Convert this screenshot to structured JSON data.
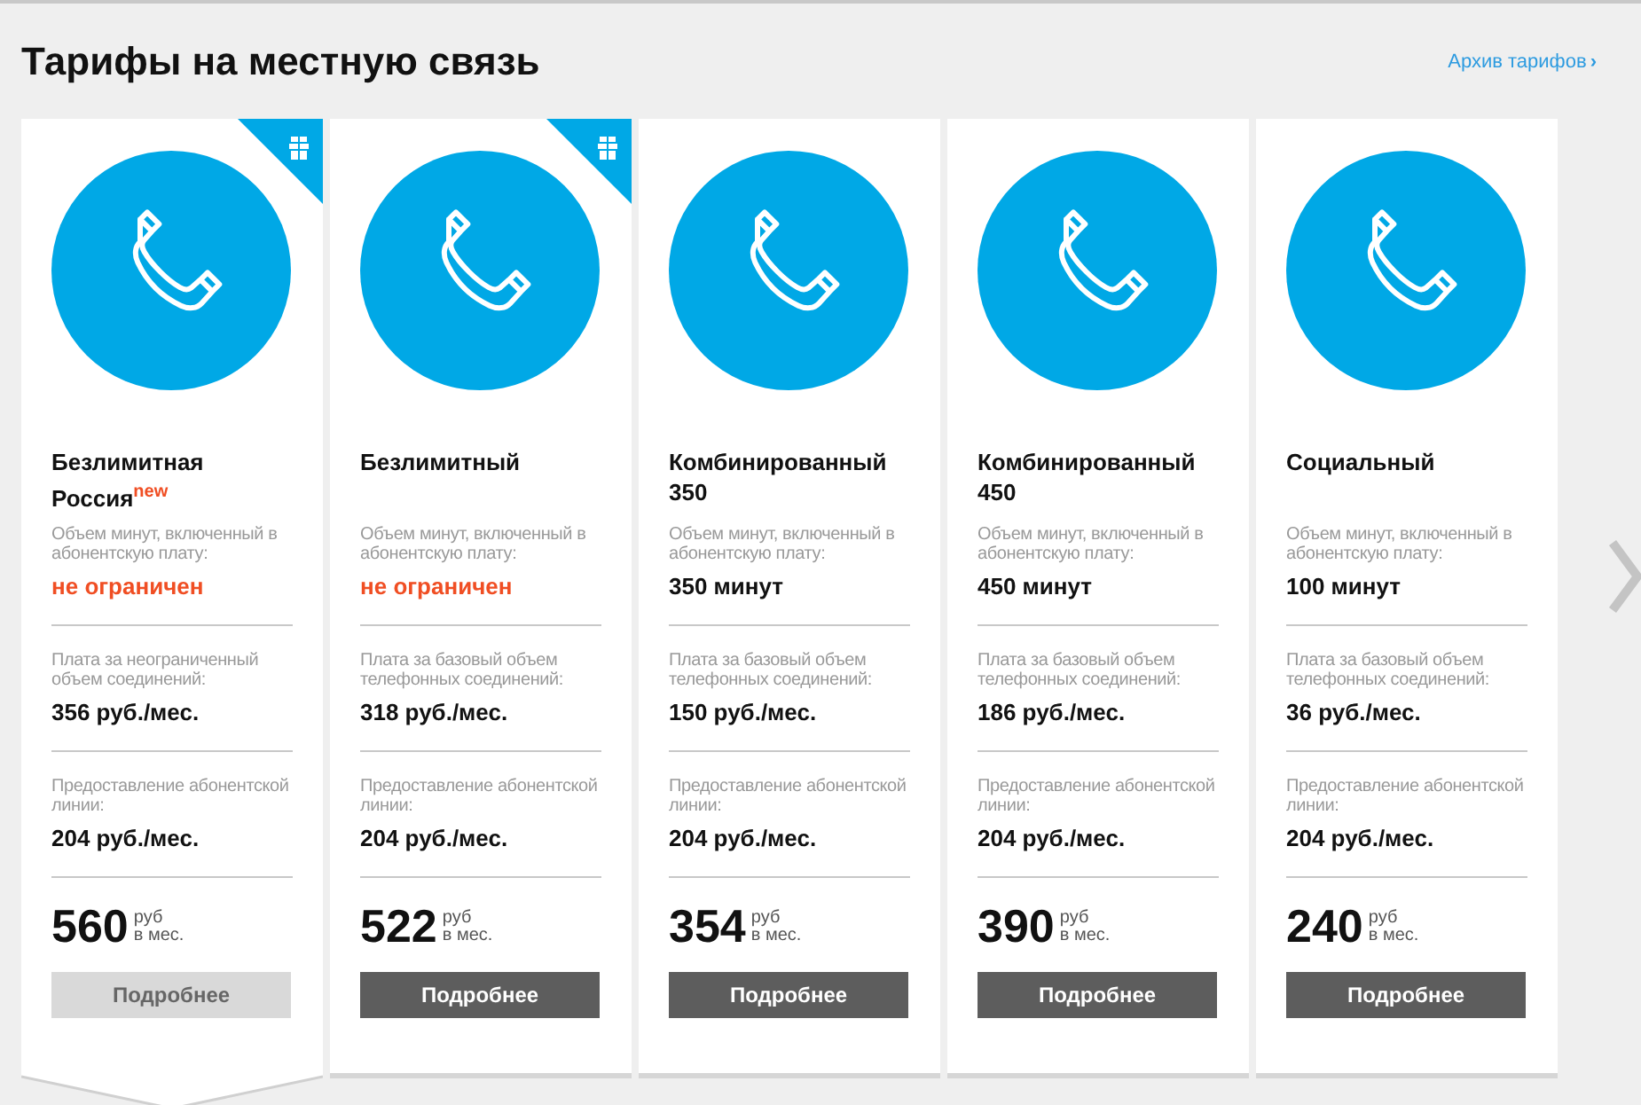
{
  "page": {
    "title": "Тарифы на местную связь",
    "archive_link": "Архив тарифов",
    "archive_arrow": "›"
  },
  "tariffs": [
    {
      "name": "Безлимитная Россия$^{new}$",
      "selected": true,
      "gift": true,
      "rows": [
        {
          "label": "Объем минут, включенный в абонентскую плату:",
          "value": "не ограничен",
          "highlight": true
        },
        {
          "label": "Плата за неограниченный объем соединений:",
          "value": "356 руб./мес.",
          "highlight": false
        },
        {
          "label": "Предоставление абонентской линии:",
          "value": "204 руб./мес.",
          "highlight": false
        }
      ],
      "price": "560",
      "unit": "руб",
      "period": "в мес.",
      "button": "Подробнее"
    },
    {
      "name": "Безлимитный",
      "selected": false,
      "gift": true,
      "rows": [
        {
          "label": "Объем минут, включенный в абонентскую плату:",
          "value": "не ограничен",
          "highlight": true
        },
        {
          "label": "Плата за базовый объем телефонных соединений:",
          "value": "318 руб./мес.",
          "highlight": false
        },
        {
          "label": "Предоставление абонентской линии:",
          "value": "204 руб./мес.",
          "highlight": false
        }
      ],
      "price": "522",
      "unit": "руб",
      "period": "в мес.",
      "button": "Подробнее"
    },
    {
      "name": "Комбинированный 350",
      "selected": false,
      "gift": false,
      "rows": [
        {
          "label": "Объем минут, включенный в абонентскую плату:",
          "value": "350 минут",
          "highlight": false
        },
        {
          "label": "Плата за базовый объем телефонных соединений:",
          "value": "150 руб./мес.",
          "highlight": false
        },
        {
          "label": "Предоставление абонентской линии:",
          "value": "204 руб./мес.",
          "highlight": false
        }
      ],
      "price": "354",
      "unit": "руб",
      "period": "в мес.",
      "button": "Подробнее"
    },
    {
      "name": "Комбинированный 450",
      "selected": false,
      "gift": false,
      "rows": [
        {
          "label": "Объем минут, включенный в абонентскую плату:",
          "value": "450 минут",
          "highlight": false
        },
        {
          "label": "Плата за базовый объем телефонных соединений:",
          "value": "186 руб./мес.",
          "highlight": false
        },
        {
          "label": "Предоставление абонентской линии:",
          "value": "204 руб./мес.",
          "highlight": false
        }
      ],
      "price": "390",
      "unit": "руб",
      "period": "в мес.",
      "button": "Подробнее"
    },
    {
      "name": "Социальный",
      "selected": false,
      "gift": false,
      "rows": [
        {
          "label": "Объем минут, включенный в абонентскую плату:",
          "value": "100 минут",
          "highlight": false
        },
        {
          "label": "Плата за базовый объем телефонных соединений:",
          "value": "36 руб./мес.",
          "highlight": false
        },
        {
          "label": "Предоставление абонентской линии:",
          "value": "204 руб./мес.",
          "highlight": false
        }
      ],
      "price": "240",
      "unit": "руб",
      "period": "в мес.",
      "button": "Подробнее"
    }
  ]
}
